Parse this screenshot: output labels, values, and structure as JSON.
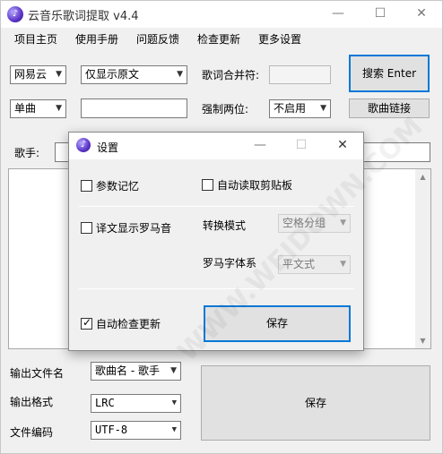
{
  "window": {
    "title": "云音乐歌词提取 v4.4",
    "minimize": "—",
    "maximize": "☐",
    "close": "✕"
  },
  "menu": [
    "项目主页",
    "使用手册",
    "问题反馈",
    "检查更新",
    "更多设置"
  ],
  "controls": {
    "source": "网易云",
    "display_mode": "仅显示原文",
    "merge_label": "歌词合并符:",
    "merge_value": "",
    "search_button": "搜索 Enter",
    "search_type": "单曲",
    "search_input": "",
    "force_two_digit_label": "强制两位:",
    "force_two_digit_value": "不启用",
    "song_link_button": "歌曲链接",
    "singer_label": "歌手:",
    "singer_value": ""
  },
  "bottom": {
    "output_filename_label": "输出文件名",
    "output_filename_value": "歌曲名 - 歌手",
    "output_format_label": "输出格式",
    "output_format_value": "LRC",
    "encoding_label": "文件编码",
    "encoding_value": "UTF-8",
    "save_button": "保存"
  },
  "dialog": {
    "title": "设置",
    "param_memory": {
      "label": "参数记忆",
      "checked": false
    },
    "auto_clipboard": {
      "label": "自动读取剪贴板",
      "checked": false
    },
    "translation_romaji": {
      "label": "译文显示罗马音",
      "checked": false
    },
    "convert_mode_label": "转换模式",
    "convert_mode_value": "空格分组",
    "romaji_font_label": "罗马字体系",
    "romaji_font_value": "平文式",
    "auto_update": {
      "label": "自动检查更新",
      "checked": true
    },
    "save_button": "保存",
    "check_mark": "✓"
  },
  "watermark": "WWW.WEIDOWN.COM"
}
